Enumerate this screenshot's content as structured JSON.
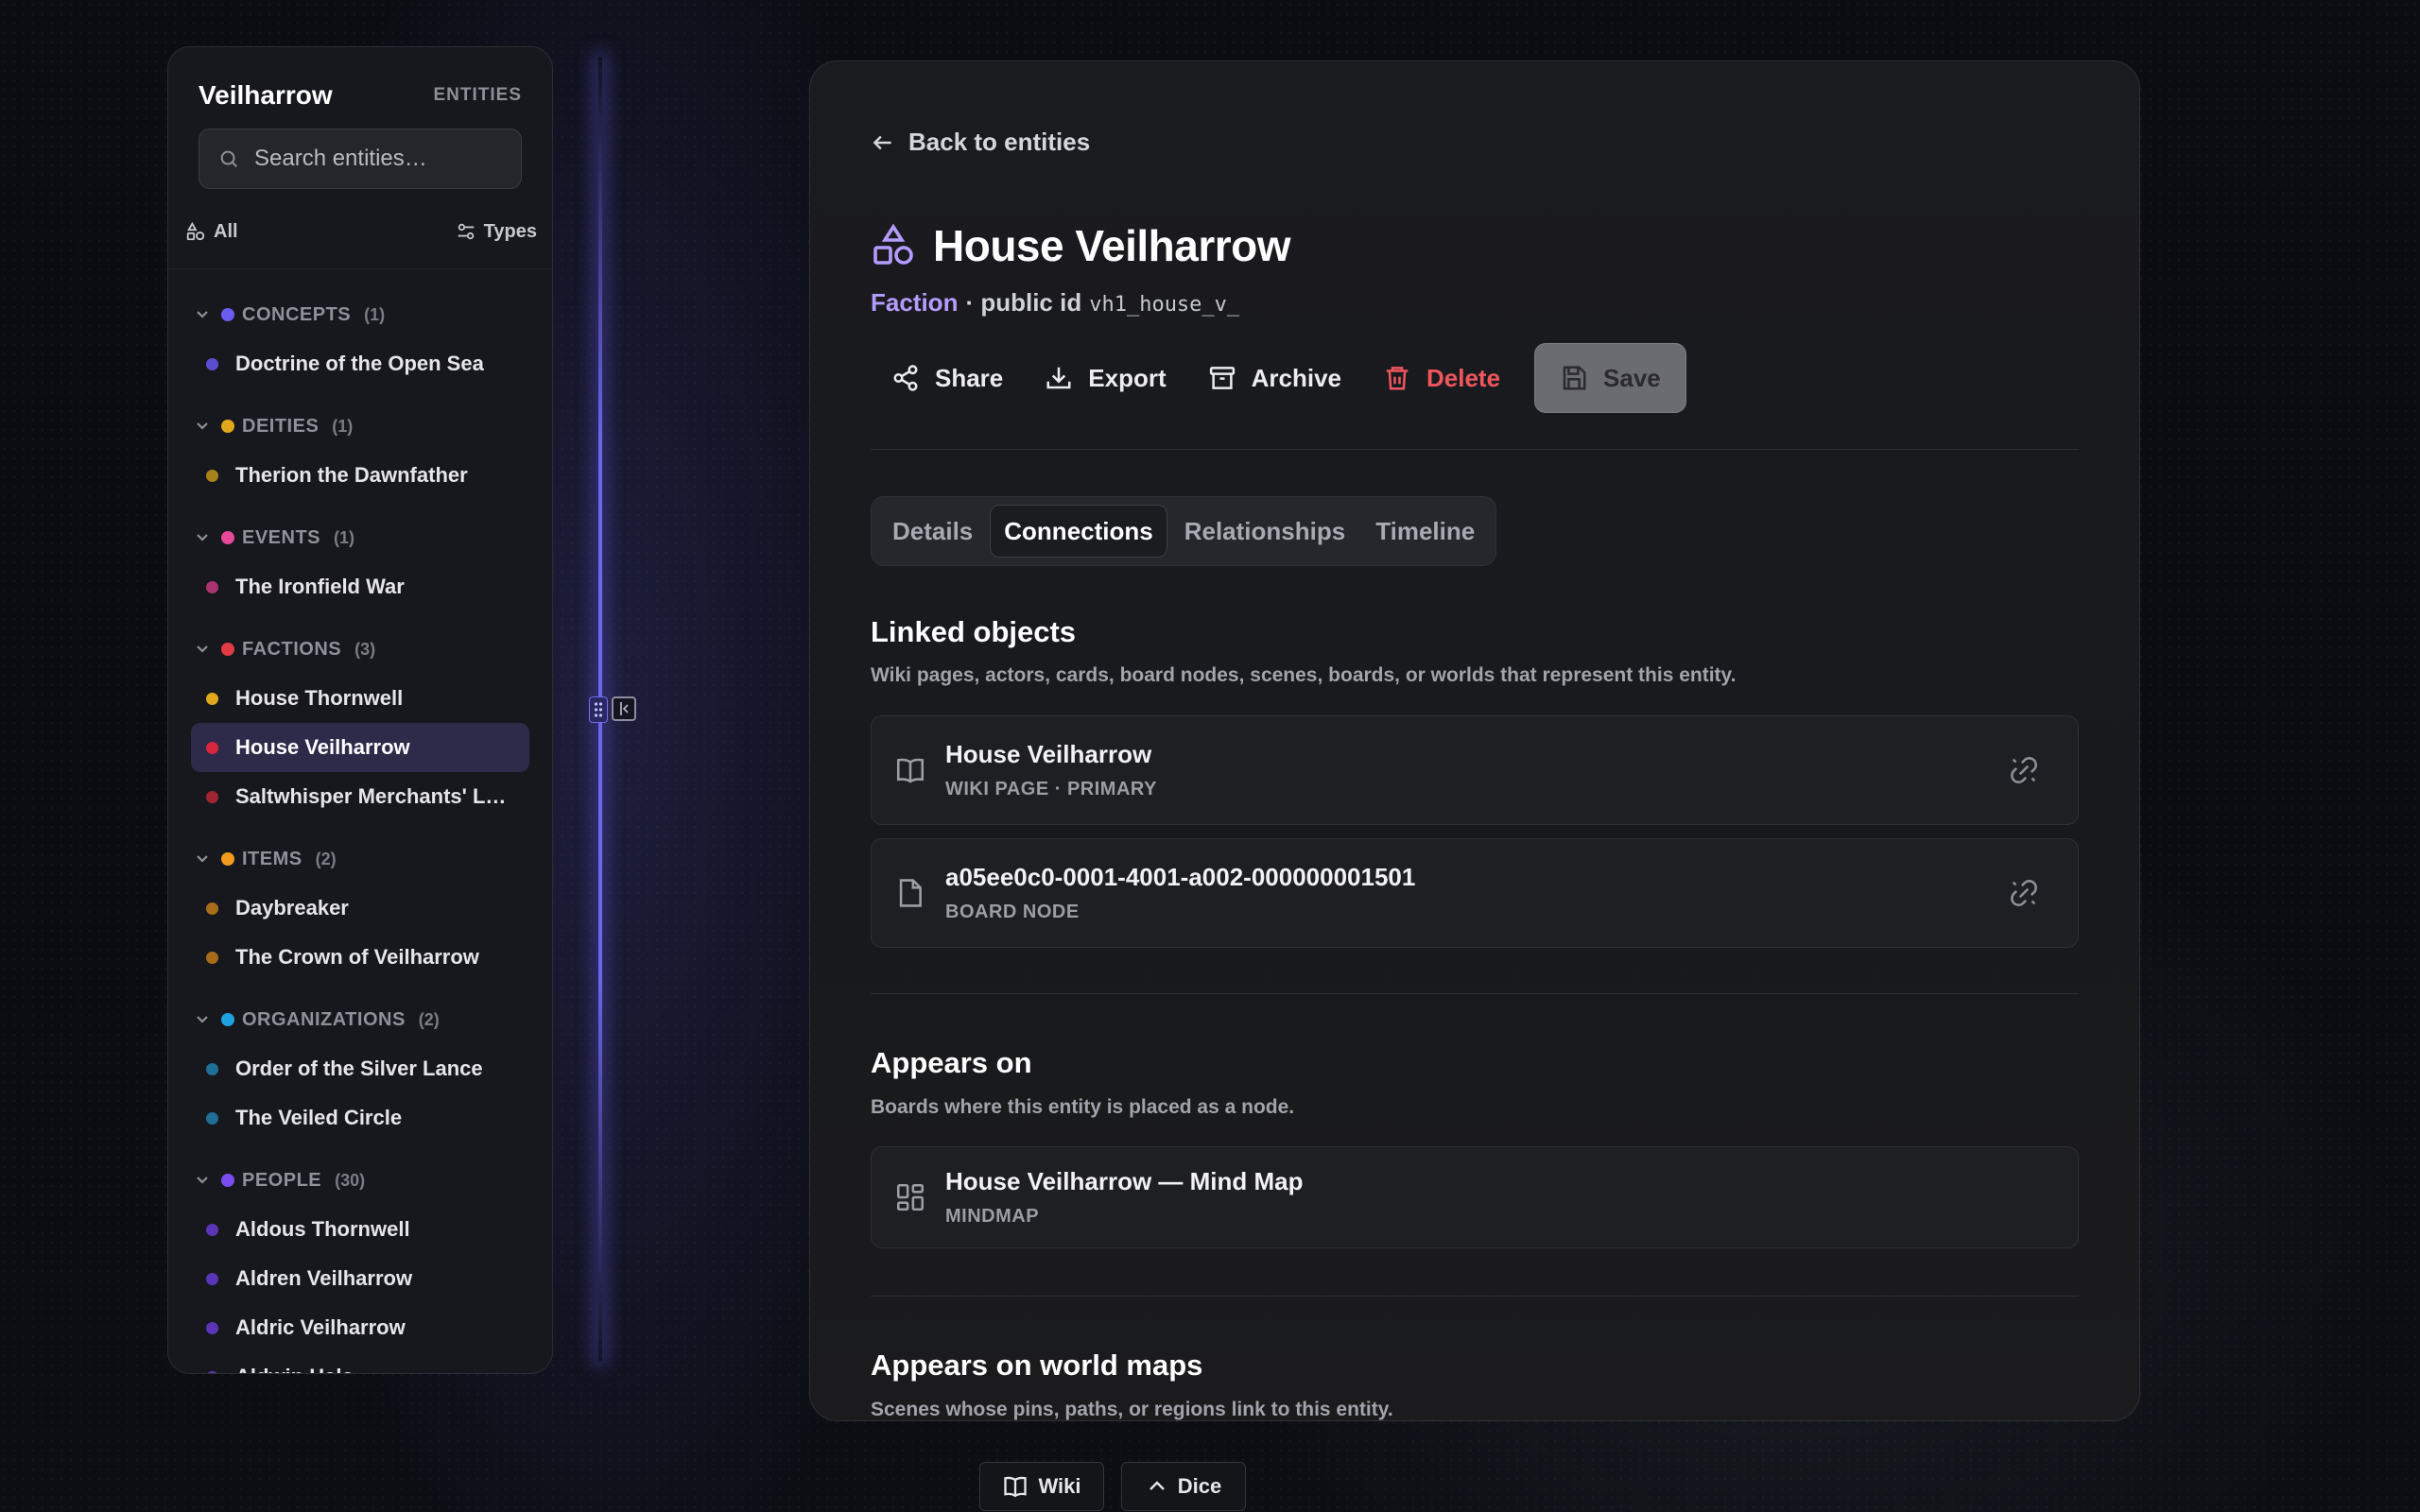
{
  "sidebar": {
    "title": "Veilharrow",
    "tag": "ENTITIES",
    "search_placeholder": "Search entities…",
    "filter_all": "All",
    "filter_types": "Types",
    "groups": [
      {
        "name": "CONCEPTS",
        "count": "(1)",
        "color": "#6b5cf0",
        "items": [
          {
            "label": "Doctrine of the Open Sea",
            "color": "#5a4fd0"
          }
        ]
      },
      {
        "name": "DEITIES",
        "count": "(1)",
        "color": "#e0a81a",
        "items": [
          {
            "label": "Therion the Dawnfather",
            "color": "#a8821a"
          }
        ]
      },
      {
        "name": "EVENTS",
        "count": "(1)",
        "color": "#e8479a",
        "items": [
          {
            "label": "The Ironfield War",
            "color": "#a8336f"
          }
        ]
      },
      {
        "name": "FACTIONS",
        "count": "(3)",
        "color": "#e23a45",
        "items": [
          {
            "label": "House Thornwell",
            "color": "#e0a81a"
          },
          {
            "label": "House Veilharrow",
            "color": "#d7263d"
          },
          {
            "label": "Saltwhisper Merchants' League",
            "color": "#9e2631"
          }
        ]
      },
      {
        "name": "ITEMS",
        "count": "(2)",
        "color": "#f29a1c",
        "items": [
          {
            "label": "Daybreaker",
            "color": "#a86d1a"
          },
          {
            "label": "The Crown of Veilharrow",
            "color": "#a86d1a"
          }
        ]
      },
      {
        "name": "ORGANIZATIONS",
        "count": "(2)",
        "color": "#1fa3e0",
        "items": [
          {
            "label": "Order of the Silver Lance",
            "color": "#1f6f96"
          },
          {
            "label": "The Veiled Circle",
            "color": "#1f6f96"
          }
        ]
      },
      {
        "name": "PEOPLE",
        "count": "(30)",
        "color": "#7b4cf0",
        "items": [
          {
            "label": "Aldous Thornwell",
            "color": "#5b35b8"
          },
          {
            "label": "Aldren Veilharrow",
            "color": "#5b35b8"
          },
          {
            "label": "Aldric Veilharrow",
            "color": "#5b35b8"
          },
          {
            "label": "Aldwin Hale",
            "color": "#5b35b8"
          }
        ]
      }
    ]
  },
  "main": {
    "back_label": "Back to entities",
    "title": "House Veilharrow",
    "type": "Faction",
    "public_id_label": "· public id",
    "public_id": "vh1_house_v_",
    "actions": {
      "share": "Share",
      "export": "Export",
      "archive": "Archive",
      "delete": "Delete",
      "save": "Save"
    },
    "tabs": [
      "Details",
      "Connections",
      "Relationships",
      "Timeline"
    ],
    "active_tab": "Connections",
    "linked": {
      "title": "Linked objects",
      "desc": "Wiki pages, actors, cards, board nodes, scenes, boards, or worlds that represent this entity.",
      "items": [
        {
          "title": "House Veilharrow",
          "sub": "WIKI PAGE · PRIMARY",
          "icon": "book-icon"
        },
        {
          "title": "a05ee0c0-0001-4001-a002-000000001501",
          "sub": "BOARD NODE",
          "icon": "file-icon"
        }
      ]
    },
    "appears_on": {
      "title": "Appears on",
      "desc": "Boards where this entity is placed as a node.",
      "items": [
        {
          "title": "House Veilharrow — Mind Map",
          "sub": "MINDMAP",
          "icon": "board-grid-icon"
        }
      ]
    },
    "world_maps": {
      "title": "Appears on world maps",
      "desc": "Scenes whose pins, paths, or regions link to this entity."
    }
  },
  "dock": {
    "wiki": "Wiki",
    "dice": "Dice"
  },
  "colors": {
    "accent": "#b49cff",
    "danger": "#f0565e",
    "splitter": "#7a6eff"
  }
}
